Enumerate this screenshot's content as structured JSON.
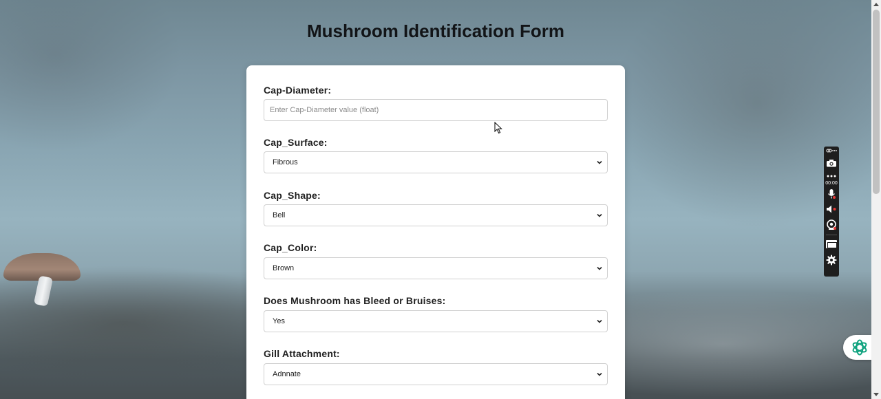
{
  "page": {
    "title": "Mushroom Identification Form"
  },
  "form": {
    "cap_diameter": {
      "label": "Cap-Diameter:",
      "value": "",
      "placeholder": "Enter Cap-Diameter value (float)"
    },
    "cap_surface": {
      "label": "Cap_Surface:",
      "selected": "Fibrous"
    },
    "cap_shape": {
      "label": "Cap_Shape:",
      "selected": "Bell"
    },
    "cap_color": {
      "label": "Cap_Color:",
      "selected": "Brown"
    },
    "bleed_bruises": {
      "label": "Does Mushroom has Bleed or Bruises:",
      "selected": "Yes"
    },
    "gill_attachment": {
      "label": "Gill Attachment:",
      "selected": "Adnnate"
    }
  },
  "recorder": {
    "timer": "00:00",
    "icons": [
      "link-icon",
      "camera-icon",
      "more-icon",
      "microphone-icon",
      "speaker-icon",
      "webcam-icon",
      "window-icon",
      "gear-icon"
    ]
  },
  "assistant": {
    "icon": "openai-logo-icon",
    "color": "#10a37f"
  }
}
